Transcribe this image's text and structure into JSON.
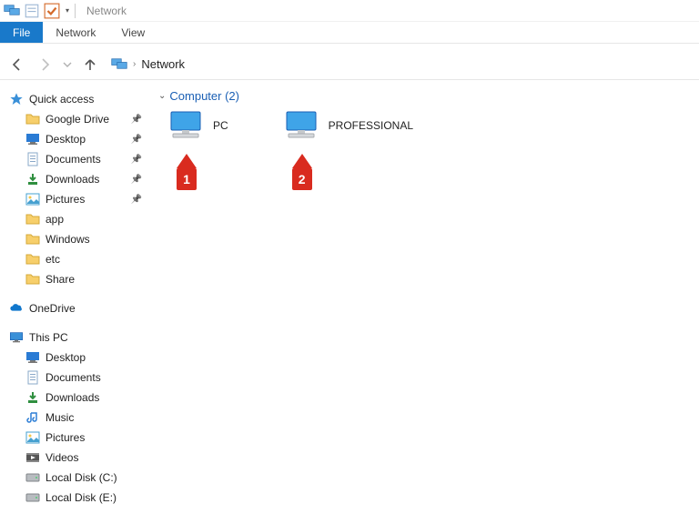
{
  "titlebar": {
    "title": "Network"
  },
  "ribbon": {
    "file": "File",
    "tabs": [
      "Network",
      "View"
    ]
  },
  "breadcrumb": {
    "items": [
      "Network"
    ]
  },
  "section": {
    "label": "Computer",
    "count": 2
  },
  "computers": [
    {
      "name": "PC",
      "callout": "1"
    },
    {
      "name": "PROFESSIONAL",
      "callout": "2"
    }
  ],
  "sidebar": {
    "quick_access": {
      "label": "Quick access",
      "items": [
        {
          "label": "Google Drive",
          "pinned": true,
          "icon": "folder"
        },
        {
          "label": "Desktop",
          "pinned": true,
          "icon": "desktop"
        },
        {
          "label": "Documents",
          "pinned": true,
          "icon": "documents"
        },
        {
          "label": "Downloads",
          "pinned": true,
          "icon": "downloads"
        },
        {
          "label": "Pictures",
          "pinned": true,
          "icon": "pictures"
        },
        {
          "label": "app",
          "pinned": false,
          "icon": "folder"
        },
        {
          "label": "Windows",
          "pinned": false,
          "icon": "folder"
        },
        {
          "label": "etc",
          "pinned": false,
          "icon": "folder"
        },
        {
          "label": "Share",
          "pinned": false,
          "icon": "folder"
        }
      ]
    },
    "onedrive": {
      "label": "OneDrive"
    },
    "this_pc": {
      "label": "This PC",
      "items": [
        {
          "label": "Desktop",
          "icon": "desktop"
        },
        {
          "label": "Documents",
          "icon": "documents"
        },
        {
          "label": "Downloads",
          "icon": "downloads"
        },
        {
          "label": "Music",
          "icon": "music"
        },
        {
          "label": "Pictures",
          "icon": "pictures"
        },
        {
          "label": "Videos",
          "icon": "videos"
        },
        {
          "label": "Local Disk (C:)",
          "icon": "disk"
        },
        {
          "label": "Local Disk (E:)",
          "icon": "disk"
        }
      ]
    }
  }
}
